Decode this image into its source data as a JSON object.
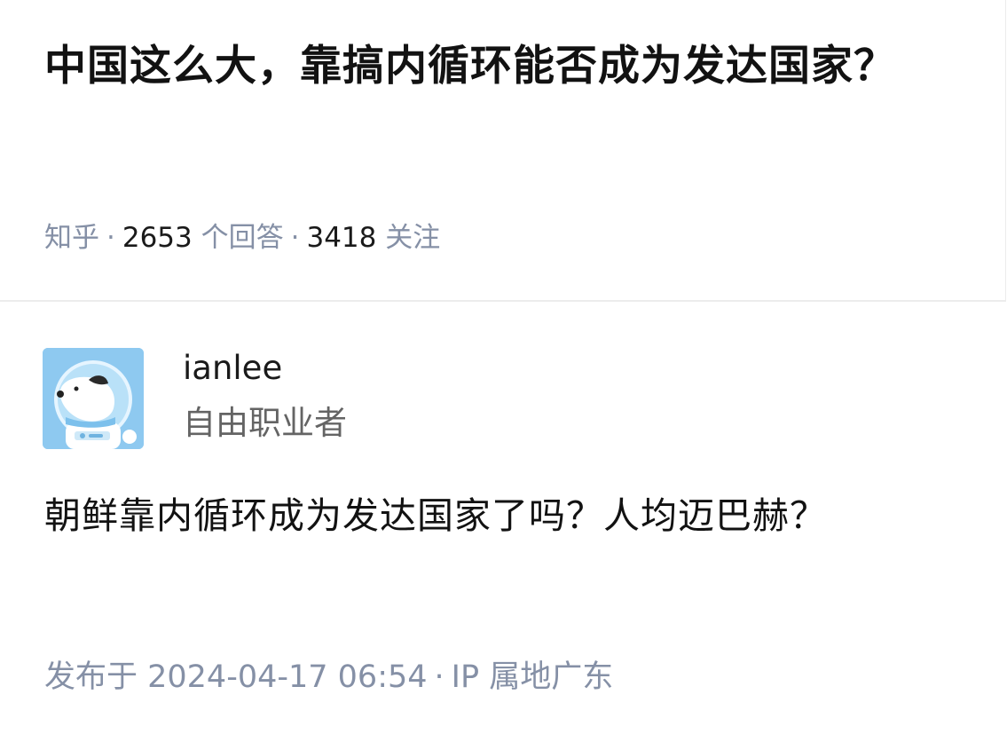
{
  "question": {
    "title": "中国这么大，靠搞内循环能否成为发达国家？",
    "source": "知乎",
    "answer_count": "2653",
    "answer_label": "个回答",
    "follow_count": "3418",
    "follow_label": "关注",
    "separator": "·"
  },
  "answer": {
    "author": {
      "name": "ianlee",
      "bio": "自由职业者",
      "avatar_icon": "astronaut-dog-avatar-icon"
    },
    "content": "朝鲜靠内循环成为发达国家了吗？人均迈巴赫？",
    "published_label": "发布于 2024-04-17 06:54",
    "separator": "·",
    "ip_location": "IP 属地广东"
  },
  "colors": {
    "avatar_background": "#8ec9f0",
    "meta_gray": "#8590a6",
    "title_black": "#121212"
  }
}
